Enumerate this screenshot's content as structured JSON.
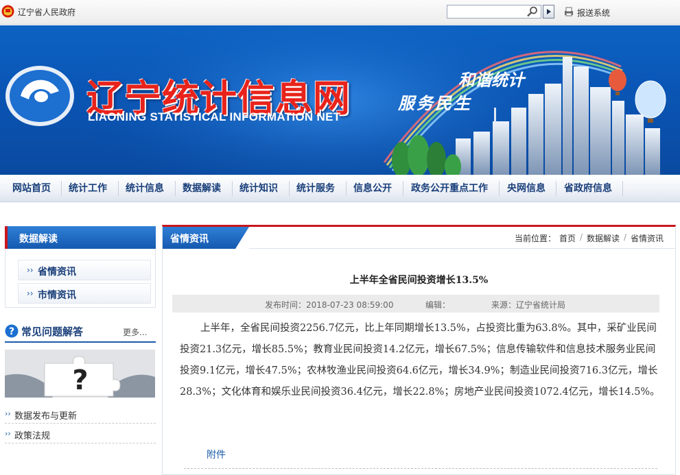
{
  "topbar": {
    "gov_name": "辽宁省人民政府",
    "search_placeholder": "",
    "report_label": "报送系统"
  },
  "banner": {
    "title": "辽宁统计信息网",
    "subtitle": "LIAONING STATISTICAL INFORMATION NET",
    "slogan_1": "和谐统计",
    "slogan_2": "服务民生"
  },
  "nav": {
    "items": [
      "网站首页",
      "统计工作",
      "统计信息",
      "数据解读",
      "统计知识",
      "统计服务",
      "信息公开",
      "政务公开重点工作",
      "央网信息",
      "省政府信息"
    ]
  },
  "sidebar": {
    "section_title": "数据解读",
    "items": [
      "省情资讯",
      "市情资讯"
    ],
    "faq_title": "常见问题解答",
    "faq_more": "更多...",
    "links": [
      "数据发布与更新",
      "政策法规"
    ]
  },
  "main": {
    "tab_label": "省情资讯",
    "breadcrumb": {
      "prefix": "当前位置：",
      "items": [
        "首页",
        "数据解读",
        "省情资讯"
      ],
      "separator": "/"
    },
    "article": {
      "title": "上半年全省民间投资增长13.5%",
      "publish_time": "发布时间：2018-07-23 08:59:00",
      "editor": "编辑：",
      "source": "来源：辽宁省统计局",
      "body": "上半年，全省民间投资2256.7亿元，比上年同期增长13.5%，占投资比重为63.8%。其中，采矿业民间投资21.3亿元，增长85.5%；教育业民间投资14.2亿元，增长67.5%；信息传输软件和信息技术服务业民间投资9.1亿元，增长47.5%；农林牧渔业民间投资64.6亿元，增长34.9%；制造业民间投资716.3亿元，增长28.3%；文化体育和娱乐业民间投资36.4亿元，增长22.8%；房地产业民间投资1072.4亿元，增长14.5%。",
      "attachment_label": "附件"
    }
  },
  "colors": {
    "brand_blue": "#1559b0",
    "accent_red": "#c8161d",
    "nav_text": "#1a3f7a"
  }
}
